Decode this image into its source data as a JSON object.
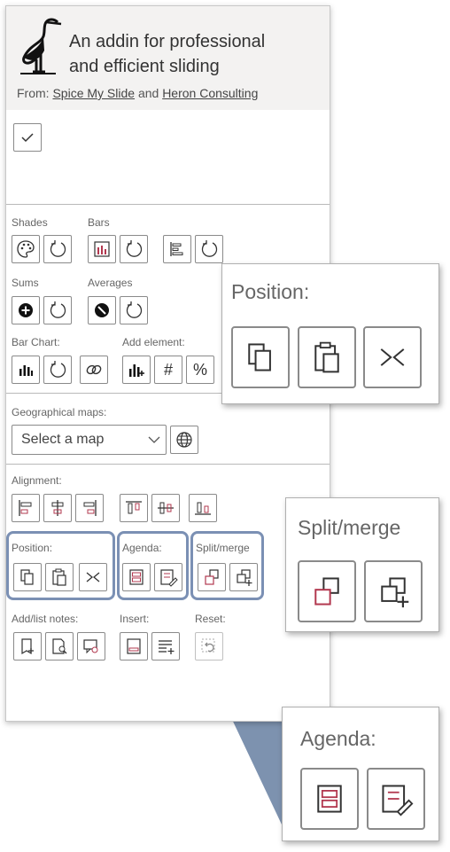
{
  "header": {
    "tagline_line1": "An addin for professional",
    "tagline_line2": "and efficient sliding",
    "from_label": "From:",
    "from_link1": "Spice My Slide",
    "from_and": "and",
    "from_link2": "Heron Consulting"
  },
  "sections": {
    "shades": "Shades",
    "bars": "Bars",
    "sums": "Sums",
    "averages": "Averages",
    "bar_chart": "Bar Chart:",
    "add_element": "Add element:",
    "hash": "#",
    "percent": "%",
    "geo_maps": "Geographical maps:",
    "alignment": "Alignment:",
    "position": "Position:",
    "agenda": "Agenda:",
    "split_merge": "Split/merge",
    "add_list_notes": "Add/list notes:",
    "insert": "Insert:",
    "reset": "Reset:"
  },
  "select": {
    "value": "Select a map"
  },
  "callouts": {
    "position": "Position:",
    "split_merge": "Split/merge",
    "agenda": "Agenda:"
  },
  "colors": {
    "accent_border": "#7b90b4",
    "zoom_fill": "#6f86a6"
  }
}
